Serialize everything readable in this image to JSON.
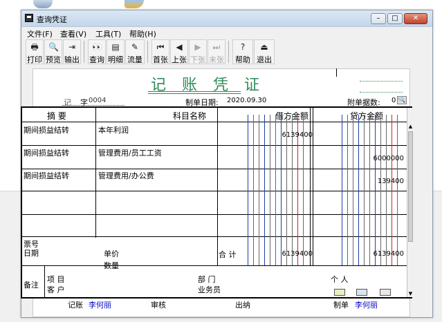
{
  "window": {
    "title": "查询凭证"
  },
  "menu": [
    "文件(F)",
    "查看(V)",
    "工具(T)",
    "帮助(H)"
  ],
  "toolbar": [
    {
      "label": "打印",
      "icon": "printer-icon",
      "glyph": "🖶",
      "enabled": true
    },
    {
      "label": "预览",
      "icon": "preview-icon",
      "glyph": "🔍",
      "enabled": true
    },
    {
      "label": "输出",
      "icon": "export-icon",
      "glyph": "⇥",
      "enabled": true
    },
    {
      "label": "查询",
      "icon": "binoculars-icon",
      "glyph": "👀",
      "enabled": true
    },
    {
      "label": "明细",
      "icon": "detail-icon",
      "glyph": "▤",
      "enabled": true
    },
    {
      "label": "流量",
      "icon": "flow-icon",
      "glyph": "✎",
      "enabled": true
    },
    {
      "label": "首张",
      "icon": "first-icon",
      "glyph": "⏮",
      "enabled": true
    },
    {
      "label": "上张",
      "icon": "prev-icon",
      "glyph": "◀",
      "enabled": true
    },
    {
      "label": "下张",
      "icon": "next-icon",
      "glyph": "▶",
      "enabled": false
    },
    {
      "label": "末张",
      "icon": "last-icon",
      "glyph": "⏭",
      "enabled": false
    },
    {
      "label": "帮助",
      "icon": "help-icon",
      "glyph": "?",
      "enabled": true
    },
    {
      "label": "退出",
      "icon": "exit-icon",
      "glyph": "⏏",
      "enabled": true
    }
  ],
  "voucher": {
    "title": "记 账 凭 证",
    "type_label": "记",
    "word_label": "字",
    "number": "0004",
    "date_label": "制单日期:",
    "date": "2020.09.30",
    "attach_label": "附单据数:",
    "attach_count": "0",
    "headers": {
      "summary": "摘 要",
      "account": "科目名称",
      "debit": "借方金额",
      "credit": "贷方金额"
    },
    "rows": [
      {
        "summary": "期间损益结转",
        "account": "本年利润",
        "debit": "6139400",
        "credit": ""
      },
      {
        "summary": "期间损益结转",
        "account": "管理费用/员工工资",
        "debit": "",
        "credit": "6000000"
      },
      {
        "summary": "期间损益结转",
        "account": "管理费用/办公费",
        "debit": "",
        "credit": "139400"
      },
      {
        "summary": "",
        "account": "",
        "debit": "",
        "credit": ""
      },
      {
        "summary": "",
        "account": "",
        "debit": "",
        "credit": ""
      }
    ],
    "ticket_label": "票号",
    "ticket_date_label": "日期",
    "unit_price_label": "单价",
    "quantity_label": "数量",
    "total_label": "合 计",
    "total_debit": "6139400",
    "total_credit": "6139400",
    "remark_label": "备注",
    "project_label": "项 目",
    "customer_label": "客 户",
    "dept_label": "部 门",
    "staff_label": "业务员",
    "person_label": "个 人"
  },
  "signatures": {
    "bookkeep_label": "记账",
    "bookkeep_name": "李何丽",
    "review_label": "审核",
    "cashier_label": "出纳",
    "maker_label": "制单",
    "maker_name": "李何丽"
  }
}
